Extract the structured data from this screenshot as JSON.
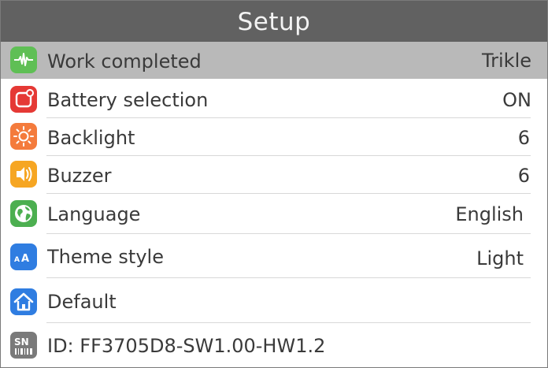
{
  "header": {
    "title": "Setup"
  },
  "items": [
    {
      "label": "Work completed",
      "value": "Trikle",
      "icon": "waveform-icon",
      "color": "#5fbf55"
    },
    {
      "label": "Battery selection",
      "value": "ON",
      "icon": "battery-icon",
      "color": "#e53935"
    },
    {
      "label": "Backlight",
      "value": "6",
      "icon": "sun-icon",
      "color": "#f47b3c"
    },
    {
      "label": "Buzzer",
      "value": "6",
      "icon": "speaker-icon",
      "color": "#f6a623"
    },
    {
      "label": "Language",
      "value": "English",
      "icon": "globe-icon",
      "color": "#4caf50"
    },
    {
      "label": "Theme style",
      "value": "Light",
      "icon": "font-size-icon",
      "color": "#2f7de1"
    },
    {
      "label": "Default",
      "value": "",
      "icon": "home-icon",
      "color": "#2f7de1"
    },
    {
      "label": "ID: FF3705D8-SW1.00-HW1.2",
      "value": "",
      "icon": "serial-number-icon",
      "color": "#7a7a7a"
    }
  ],
  "selected_index": 0
}
